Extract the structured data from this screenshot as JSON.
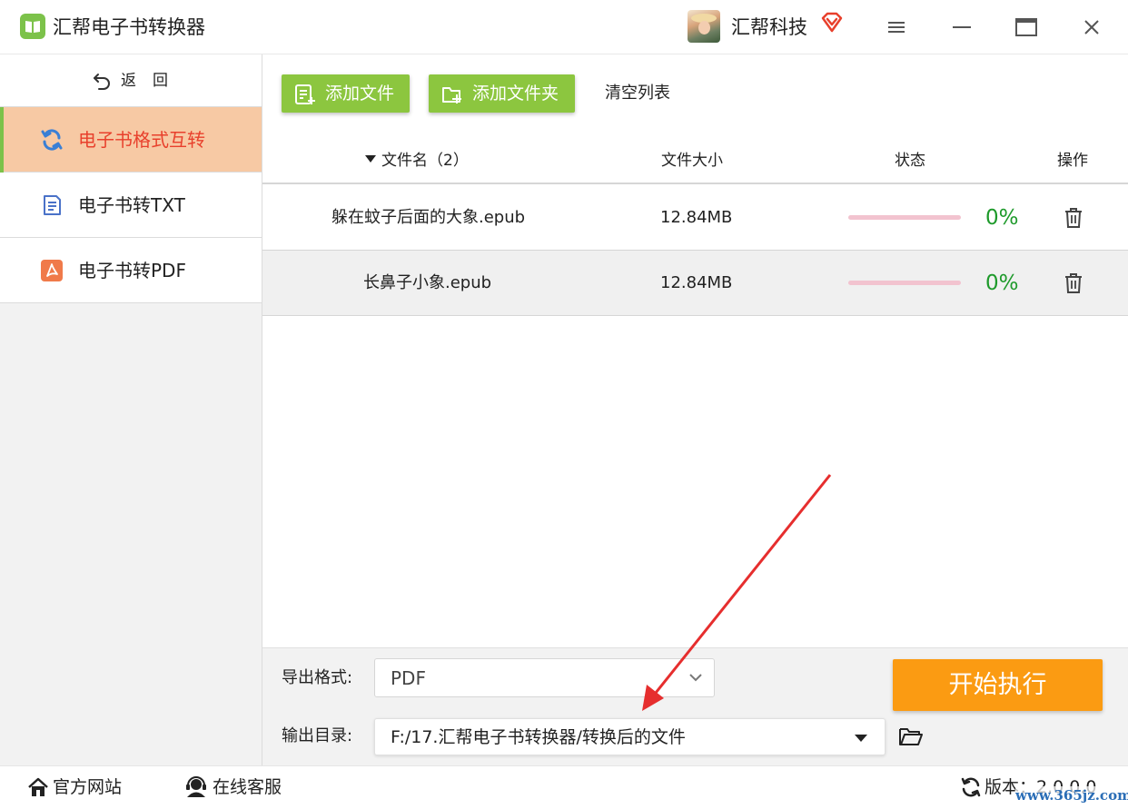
{
  "app": {
    "title": "汇帮电子书转换器",
    "company": "汇帮科技"
  },
  "sidebar": {
    "back_label": "返回",
    "items": [
      {
        "label": "电子书格式互转",
        "icon": "refresh-icon",
        "active": true
      },
      {
        "label": "电子书转TXT",
        "icon": "document-icon",
        "active": false
      },
      {
        "label": "电子书转PDF",
        "icon": "pdf-icon",
        "active": false
      }
    ]
  },
  "toolbar": {
    "add_file_label": "添加文件",
    "add_folder_label": "添加文件夹",
    "clear_list_label": "清空列表"
  },
  "table": {
    "headers": {
      "name": "文件名（2）",
      "size": "文件大小",
      "status": "状态",
      "op": "操作"
    },
    "rows": [
      {
        "name": "躲在蚊子后面的大象.epub",
        "size": "12.84MB",
        "progress_percent": 0,
        "progress_text": "0%"
      },
      {
        "name": "长鼻子小象.epub",
        "size": "12.84MB",
        "progress_percent": 0,
        "progress_text": "0%"
      }
    ]
  },
  "settings": {
    "format_label": "导出格式:",
    "format_value": "PDF",
    "dir_label": "输出目录:",
    "dir_value": "F:/17.汇帮电子书转换器/转换后的文件",
    "start_label": "开始执行"
  },
  "statusbar": {
    "site_label": "官方网站",
    "service_label": "在线客服",
    "version_text": "版本：2.0.0.0"
  },
  "watermark": "www.365jz.com",
  "colors": {
    "accent_green": "#8cc63f",
    "active_nav_bg": "#f7c9a4",
    "active_nav_text": "#e8402c",
    "start_button": "#fb9b12",
    "progress_text": "#1e9a2b",
    "annotation_arrow": "#e62e2e"
  }
}
